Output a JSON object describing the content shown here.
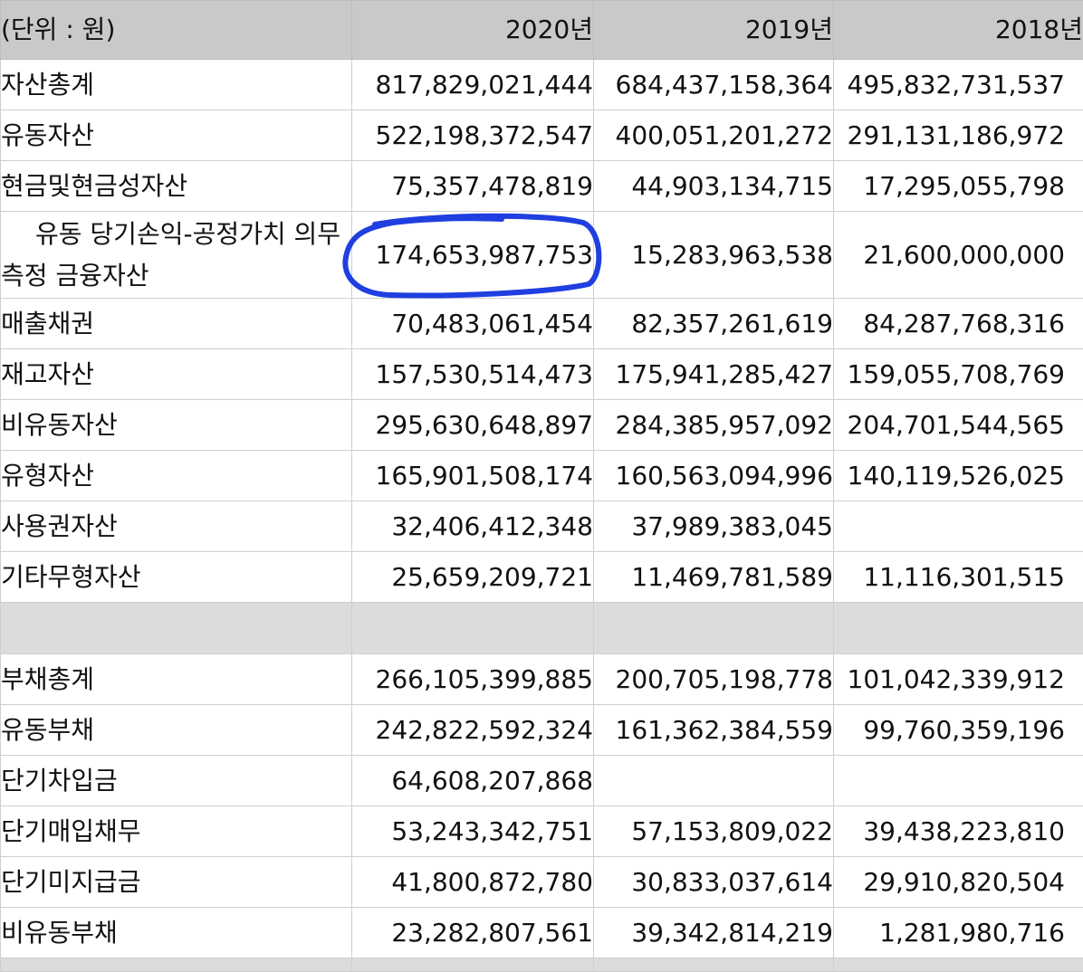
{
  "header": {
    "unit": "(단위 : 원)",
    "years": [
      "2020년",
      "2019년",
      "2018년"
    ]
  },
  "rows": [
    {
      "label": "자산총계",
      "values": [
        "817,829,021,444",
        "684,437,158,364",
        "495,832,731,537"
      ]
    },
    {
      "label": "유동자산",
      "values": [
        "522,198,372,547",
        "400,051,201,272",
        "291,131,186,972"
      ]
    },
    {
      "label": "현금및현금성자산",
      "values": [
        "75,357,478,819",
        "44,903,134,715",
        "17,295,055,798"
      ]
    },
    {
      "label": "유동 당기손익-공정가치 의무 측정 금융자산",
      "values": [
        "174,653,987,753",
        "15,283,963,538",
        "21,600,000,000"
      ]
    },
    {
      "label": "매출채권",
      "values": [
        "70,483,061,454",
        "82,357,261,619",
        "84,287,768,316"
      ]
    },
    {
      "label": "재고자산",
      "values": [
        "157,530,514,473",
        "175,941,285,427",
        "159,055,708,769"
      ]
    },
    {
      "label": "비유동자산",
      "values": [
        "295,630,648,897",
        "284,385,957,092",
        "204,701,544,565"
      ]
    },
    {
      "label": "유형자산",
      "values": [
        "165,901,508,174",
        "160,563,094,996",
        "140,119,526,025"
      ]
    },
    {
      "label": "사용권자산",
      "values": [
        "32,406,412,348",
        "37,989,383,045",
        ""
      ]
    },
    {
      "label": "기타무형자산",
      "values": [
        "25,659,209,721",
        "11,469,781,589",
        "11,116,301,515"
      ]
    },
    {
      "label": "부채총계",
      "values": [
        "266,105,399,885",
        "200,705,198,778",
        "101,042,339,912"
      ]
    },
    {
      "label": "유동부채",
      "values": [
        "242,822,592,324",
        "161,362,384,559",
        "99,760,359,196"
      ]
    },
    {
      "label": "단기차입금",
      "values": [
        "64,608,207,868",
        "",
        ""
      ]
    },
    {
      "label": "단기매입채무",
      "values": [
        "53,243,342,751",
        "57,153,809,022",
        "39,438,223,810"
      ]
    },
    {
      "label": "단기미지급금",
      "values": [
        "41,800,872,780",
        "30,833,037,614",
        "29,910,820,504"
      ]
    },
    {
      "label": "비유동부채",
      "values": [
        "23,282,807,561",
        "39,342,814,219",
        "1,281,980,716"
      ]
    }
  ],
  "annotation": {
    "color": "#1f3fe0"
  }
}
